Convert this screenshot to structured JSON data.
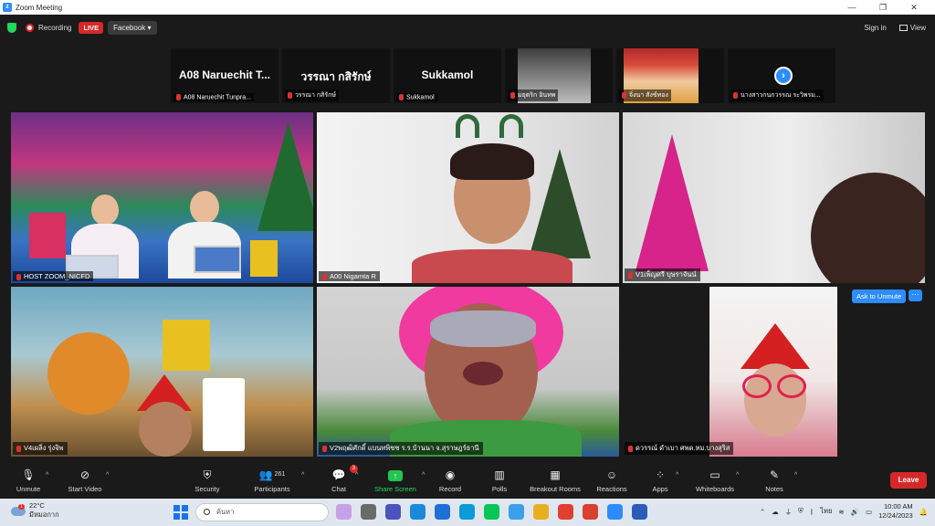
{
  "window": {
    "title": "Zoom Meeting",
    "controls": [
      "—",
      "❐",
      "✕"
    ]
  },
  "topbar": {
    "recording_label": "Recording",
    "live_label": "LIVE",
    "stream_target": "Facebook ▾",
    "sign_in": "Sign in",
    "view": "View"
  },
  "strip": [
    {
      "display": "A08 Naruechit T...",
      "name": "A08 Naruechit Tunpra..."
    },
    {
      "display": "วรรณา กสิรักษ์",
      "name": "วรรณา กสิรักษ์"
    },
    {
      "display": "Sukkamol",
      "name": "Sukkamol"
    },
    {
      "display": "",
      "name": "มยุตริก อินทพ"
    },
    {
      "display": "",
      "name": "จิ่งนา สังข์ทอง"
    },
    {
      "display": "",
      "name": "นางสาวกนกวรรณ ระวิพรม..."
    }
  ],
  "tiles": [
    {
      "name": "HOST ZOOM_NICFD"
    },
    {
      "name": "A00 Nigamta R"
    },
    {
      "name": "V1เพ็ญศรี บุษราจันน์"
    },
    {
      "name": "V4เผลิ่ง รุ่งจิพ"
    },
    {
      "name": "V2พฤฒิศักดิ์ แบนทพิชช ร.ร.บ้านนา จ.สุราษฎร์ธานี"
    },
    {
      "name": "ดวรรณ์ ดำเบา ศพด.หม.บางสุริส"
    }
  ],
  "ask_to_unmute": "Ask to Unmute",
  "more_menu": "···",
  "controls": {
    "unmute": "Unmute",
    "start_video": "Start Video",
    "security": "Security",
    "participants": "Participants",
    "participants_count": "261",
    "chat": "Chat",
    "chat_badge": "3",
    "share_screen": "Share Screen",
    "record": "Record",
    "polls": "Polls",
    "breakout_rooms": "Breakout Rooms",
    "reactions": "Reactions",
    "apps": "Apps",
    "whiteboards": "Whiteboards",
    "notes": "Notes",
    "leave": "Leave"
  },
  "taskbar": {
    "temperature": "22°C",
    "weather_desc": "มีหมอกาก",
    "weather_badge": "1",
    "search_placeholder": "ค้นหา",
    "language": "ไทย",
    "time": "10:00 AM",
    "date": "12/24/2023"
  }
}
